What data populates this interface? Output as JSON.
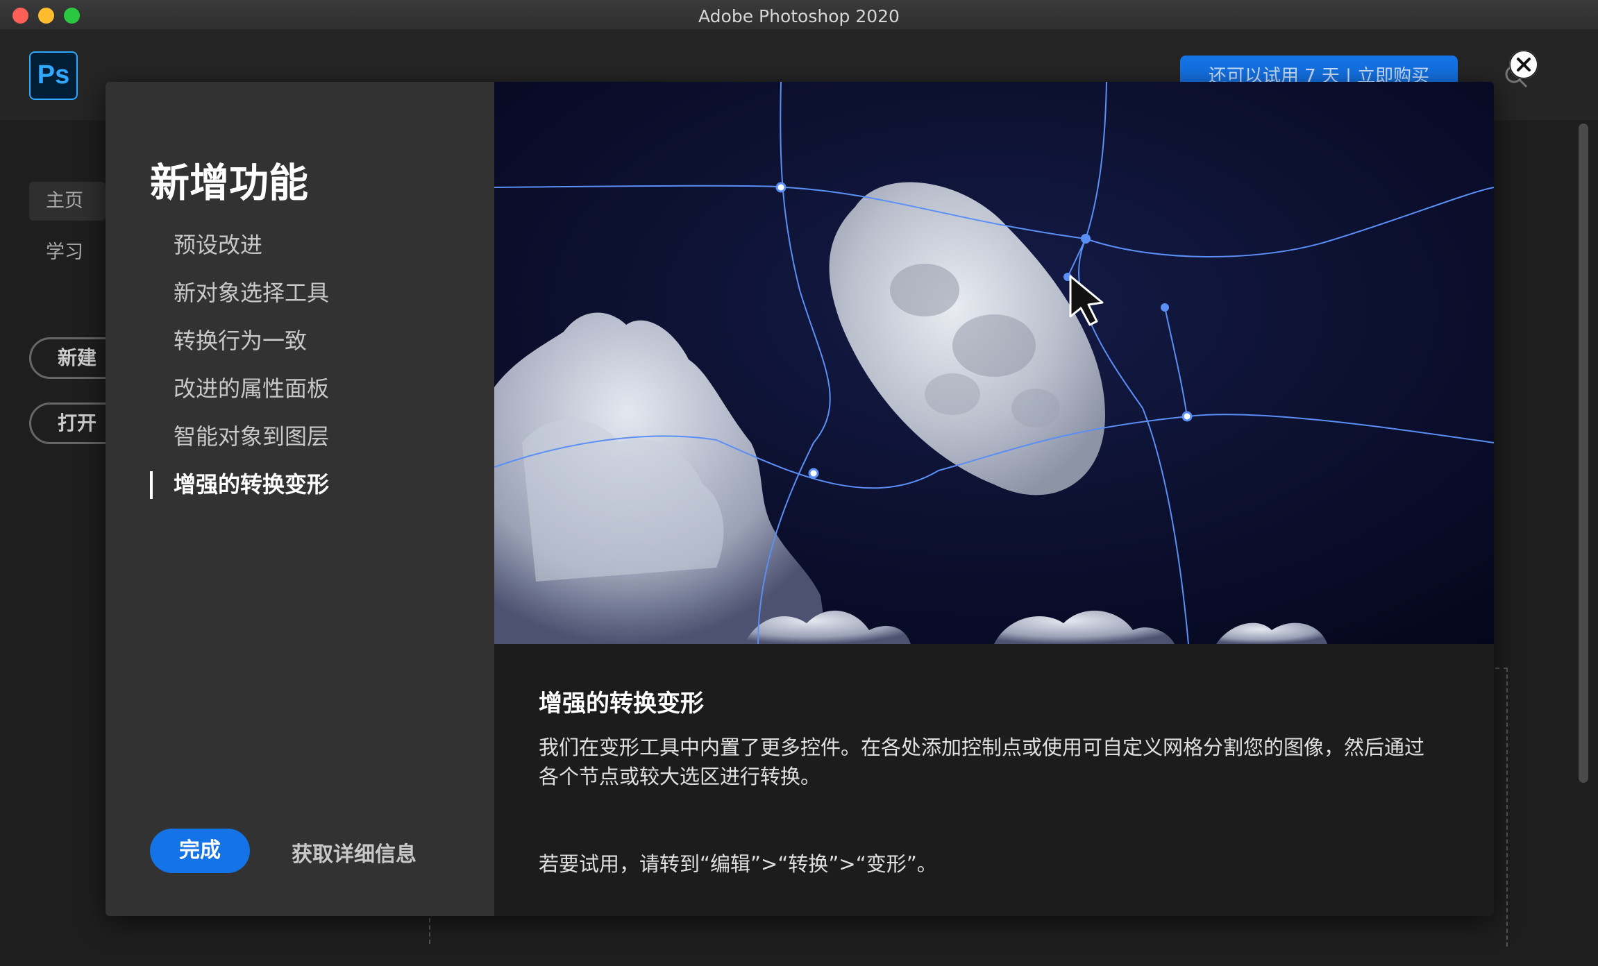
{
  "window": {
    "title": "Adobe Photoshop 2020"
  },
  "home": {
    "logo": "Ps",
    "trial_button": "还可以试用 7 天 | 立即购买",
    "nav": [
      "主页",
      "学习"
    ],
    "buttons": [
      "新建",
      "打开"
    ]
  },
  "dialog": {
    "heading": "新增功能",
    "features": [
      "预设改进",
      "新对象选择工具",
      "转换行为一致",
      "改进的属性面板",
      "智能对象到图层",
      "增强的转换变形"
    ],
    "active_index": 5,
    "done_button": "完成",
    "more_info_link": "获取详细信息",
    "detail": {
      "title": "增强的转换变形",
      "body": "我们在变形工具中内置了更多控件。在各处添加控制点或使用可自定义网格分割您的图像，然后通过各个节点或较大选区进行转换。",
      "try": "若要试用，请转到“编辑”>“转换”>“变形”。"
    }
  },
  "icons": {
    "close": "close-icon",
    "search": "search-icon",
    "cursor": "mouse-pointer-icon"
  },
  "colors": {
    "accent": "#1473e6",
    "warp_grid": "#5b8ff5",
    "sky": "#05071e"
  }
}
